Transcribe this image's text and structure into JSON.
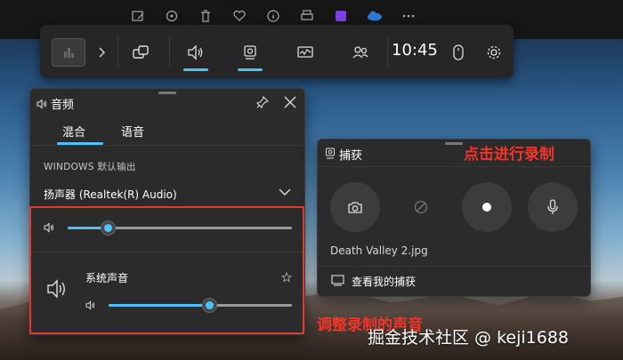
{
  "gamebar": {
    "time": "10:45"
  },
  "audio_panel": {
    "title": "音频",
    "tabs": [
      "混合",
      "语音"
    ],
    "output_heading": "WINDOWS 默认输出",
    "device": "扬声器 (Realtek(R) Audio)",
    "master_volume": 0.18,
    "apps": [
      {
        "name": "系统声音",
        "volume": 0.55
      }
    ]
  },
  "capture_panel": {
    "title": "捕获",
    "last_capture": "Death Valley 2.jpg",
    "view_captures": "查看我的捕获"
  },
  "annotations": {
    "record_hint": "点击进行录制",
    "adjust_hint": "调整录制的声音"
  },
  "watermark": "掘金技术社区 @ keji1688",
  "colors": {
    "accent": "#4cc2ff",
    "highlight": "#e03b2e",
    "panel": "#2b2b2b"
  }
}
